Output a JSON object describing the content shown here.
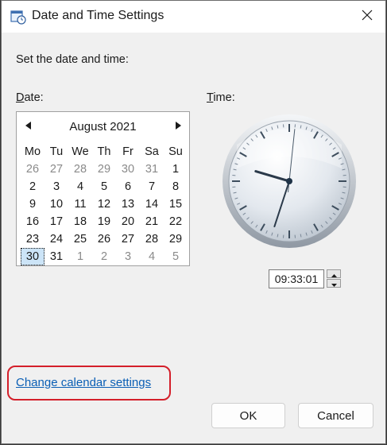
{
  "window": {
    "title": "Date and Time Settings"
  },
  "heading": "Set the date and time:",
  "date_label": {
    "access_key": "D",
    "rest": "ate:"
  },
  "time_label": {
    "access_key": "T",
    "rest": "ime:"
  },
  "calendar": {
    "month_label": "August 2021",
    "weekdays": [
      "Mo",
      "Tu",
      "We",
      "Th",
      "Fr",
      "Sa",
      "Su"
    ],
    "weeks": [
      [
        "26",
        "27",
        "28",
        "29",
        "30",
        "31",
        "1"
      ],
      [
        "2",
        "3",
        "4",
        "5",
        "6",
        "7",
        "8"
      ],
      [
        "9",
        "10",
        "11",
        "12",
        "13",
        "14",
        "15"
      ],
      [
        "16",
        "17",
        "18",
        "19",
        "20",
        "21",
        "22"
      ],
      [
        "23",
        "24",
        "25",
        "26",
        "27",
        "28",
        "29"
      ],
      [
        "30",
        "31",
        "1",
        "2",
        "3",
        "4",
        "5"
      ]
    ],
    "selected_day": "30"
  },
  "clock": {
    "hours": 9,
    "minutes": 33,
    "seconds": 1
  },
  "time_value": "09:33:01",
  "change_calendar_link": "Change calendar settings",
  "buttons": {
    "ok": "OK",
    "cancel": "Cancel"
  },
  "colors": {
    "link": "#0b5fb5",
    "highlight": "#d41f2a",
    "selected_day": "#cce4f7"
  }
}
